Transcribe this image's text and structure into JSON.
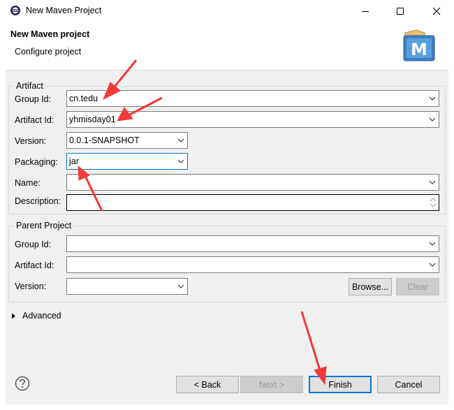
{
  "window": {
    "title": "New Maven Project",
    "icon": "eclipse-icon",
    "controls": [
      "minimize-icon",
      "maximize-icon",
      "close-icon"
    ]
  },
  "header": {
    "title": "New Maven project",
    "subtitle": "Configure project",
    "logo_letter": "M"
  },
  "artifact": {
    "legend": "Artifact",
    "group_id_label": "Group Id:",
    "group_id_value": "cn.tedu",
    "artifact_id_label": "Artifact Id:",
    "artifact_id_value": "yhmisday01",
    "version_label": "Version:",
    "version_value": "0.0.1-SNAPSHOT",
    "packaging_label": "Packaging:",
    "packaging_value": "jar",
    "name_label": "Name:",
    "name_value": "",
    "description_label": "Description:",
    "description_value": ""
  },
  "parent": {
    "legend": "Parent Project",
    "group_id_label": "Group Id:",
    "group_id_value": "",
    "artifact_id_label": "Artifact Id:",
    "artifact_id_value": "",
    "version_label": "Version:",
    "version_value": "",
    "browse_label": "Browse...",
    "clear_label": "Clear"
  },
  "advanced": {
    "label": "Advanced"
  },
  "footer": {
    "help_icon": "help-icon",
    "back_label": "< Back",
    "next_label": "Next >",
    "finish_label": "Finish",
    "cancel_label": "Cancel"
  },
  "colors": {
    "accent": "#0078d7",
    "annotation_arrow": "#f03a3a",
    "panel_bg": "#f0f0f0"
  }
}
